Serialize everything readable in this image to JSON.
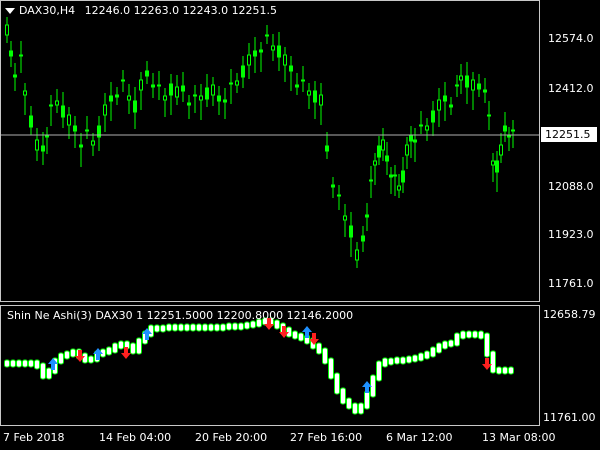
{
  "main": {
    "symbol": "DAX30,H4",
    "ohlc": "12246.0 12263.0 12243.0 12251.5",
    "price_labels": [
      "12574.0",
      "12412.0",
      "12088.0",
      "11923.0",
      "11761.0"
    ],
    "current_price": "12251.5"
  },
  "indicator": {
    "title": "Shin Ne Ashi(3) DAX30 1 12251.5000 12200.8000 12146.2000",
    "price_labels": [
      "12658.79",
      "11761.00"
    ]
  },
  "time_axis": [
    "7 Feb 2018",
    "14 Feb 04:00",
    "20 Feb 20:00",
    "27 Feb 16:00",
    "6 Mar 12:00",
    "13 Mar 08:00"
  ],
  "colors": {
    "background": "#000000",
    "candle": "#00ff00",
    "grid_line": "#c8c8c8",
    "arrow_up": "#1e90ff",
    "arrow_down": "#ff2020",
    "block_fill": "#ffffff",
    "block_border": "#00ff00"
  }
}
